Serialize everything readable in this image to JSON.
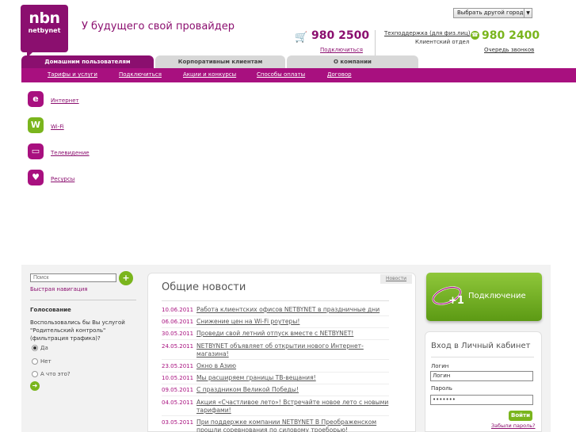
{
  "header": {
    "logo_top": "nbn",
    "logo_bottom": "netbynet",
    "slogan": "У будущего свой провайдер",
    "city_select": "Выбрать другой город",
    "phone_sales": "980 2500",
    "connect_link": "Подключиться",
    "support_link": "Техподдержка (для физ.лиц)",
    "client_dept": "Клиентский отдел",
    "phone_support": "980 2400",
    "queue_link": "Очередь звонков"
  },
  "tabs": [
    {
      "label": "Домашним пользователям",
      "active": true
    },
    {
      "label": "Корпоративным клиентам",
      "active": false
    },
    {
      "label": "О компании",
      "active": false
    }
  ],
  "subnav": [
    "Тарифы и услуги",
    "Подключиться",
    "Акции и конкурсы",
    "Способы оплаты",
    "Договор"
  ],
  "services": [
    {
      "label": "Интернет",
      "icon": "internet-icon",
      "glyph": "e"
    },
    {
      "label": "Wi-Fi",
      "icon": "wifi-icon",
      "glyph": "W"
    },
    {
      "label": "Телевидение",
      "icon": "tv-icon",
      "glyph": "▭"
    },
    {
      "label": "Ресурсы",
      "icon": "resources-icon",
      "glyph": "♥"
    }
  ],
  "sidebar": {
    "search_placeholder": "Поиск",
    "quick_nav": "Быстрая навигация",
    "poll_title": "Голосование",
    "poll_question": "Воспользовались бы Вы услугой \"Родительский контроль\" (фильтрация трафика)?",
    "poll_options": [
      {
        "label": "Да",
        "selected": true
      },
      {
        "label": "Нет",
        "selected": false
      },
      {
        "label": "А что это?",
        "selected": false
      }
    ]
  },
  "news": {
    "title": "Общие новости",
    "tag": "Новости",
    "items": [
      {
        "date": "10.06.2011",
        "text": "Работа клиентских офисов NETBYNET в праздничные дни"
      },
      {
        "date": "06.06.2011",
        "text": "Снижение цен на Wi-Fi роутеры!"
      },
      {
        "date": "30.05.2011",
        "text": "Проведи свой летний отпуск вместе с NETBYNET!"
      },
      {
        "date": "24.05.2011",
        "text": "NETBYNET объявляет об открытии нового Интернет-магазина!"
      },
      {
        "date": "23.05.2011",
        "text": "Окно в Азию"
      },
      {
        "date": "10.05.2011",
        "text": "Мы расширяем границы ТВ-вещания!"
      },
      {
        "date": "09.05.2011",
        "text": "С праздником Великой Победы!"
      },
      {
        "date": "04.05.2011",
        "text": "Акция «Счастливое лето»! Встречайте новое лето с новыми тарифами!"
      },
      {
        "date": "03.05.2011",
        "text": "При поддержке компании NETBYNET В Преображенском прошли соревнования по силовому троеборью!"
      }
    ]
  },
  "connect_banner": "Подключение",
  "login": {
    "title": "Вход в Личный кабинет",
    "login_label": "Логин",
    "login_value": "Логин",
    "password_label": "Пароль",
    "password_value": "•••••••",
    "submit": "Войти",
    "forgot": "Забыли пароль?"
  },
  "colors": {
    "brand": "#8b0f6f",
    "accent_green": "#7ab51d"
  }
}
